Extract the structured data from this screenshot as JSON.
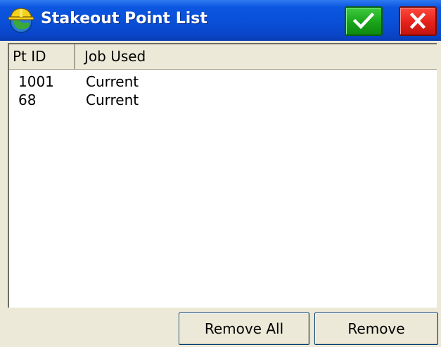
{
  "window": {
    "title": "Stakeout Point List",
    "app_icon": "survey-hardhat-icon",
    "ok_icon": "checkmark-icon",
    "close_icon": "close-icon",
    "colors": {
      "titlebar": "#0a4fd8",
      "ok_button": "#19a319",
      "close_button": "#e4211a",
      "panel": "#ece9d8"
    }
  },
  "list": {
    "columns": [
      "Pt ID",
      "Job Used"
    ],
    "rows": [
      {
        "pt_id": "1001",
        "job_used": "Current"
      },
      {
        "pt_id": "68",
        "job_used": "Current"
      }
    ]
  },
  "buttons": {
    "remove_all": "Remove All",
    "remove": "Remove"
  }
}
